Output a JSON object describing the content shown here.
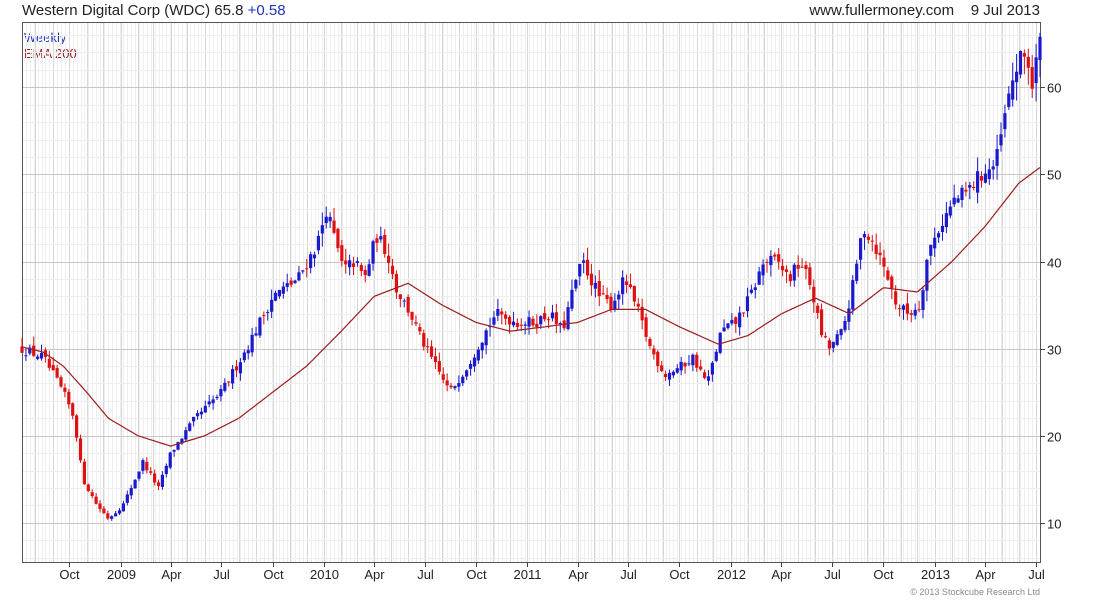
{
  "header": {
    "title": "Western Digital Corp (WDC) 65.8",
    "change": "+0.58",
    "source": "www.fullermoney.com",
    "date": "9 Jul 2013"
  },
  "legend": {
    "weekly": "Weekly",
    "ema": "EMA 200"
  },
  "copyright": "© 2013 Stockcube Research Ltd",
  "colors": {
    "up": "#1a1acc",
    "down": "#dd1111",
    "ema": "#9b1c1c",
    "grid": "#c8c8c8",
    "weekly_text": "#2233bb",
    "ema_text": "#9b1c1c"
  },
  "chart_data": {
    "type": "candlestick",
    "title": "Western Digital Corp (WDC) 65.8 +0.58",
    "interval": "Weekly",
    "y_axis_position": "right",
    "ylim": [
      5.5,
      67.5
    ],
    "yticks": [
      10,
      20,
      30,
      40,
      50,
      60
    ],
    "ytick_labels": [
      "10",
      "20",
      "30",
      "40",
      "50",
      "60"
    ],
    "xlim": [
      "2008-07-08",
      "2013-07-09"
    ],
    "xticks": [
      {
        "date": "2008-10-01",
        "label": "Oct"
      },
      {
        "date": "2009-01-01",
        "label": "2009"
      },
      {
        "date": "2009-04-01",
        "label": "Apr"
      },
      {
        "date": "2009-07-01",
        "label": "Jul"
      },
      {
        "date": "2009-10-01",
        "label": "Oct"
      },
      {
        "date": "2010-01-01",
        "label": "2010"
      },
      {
        "date": "2010-04-01",
        "label": "Apr"
      },
      {
        "date": "2010-07-01",
        "label": "Jul"
      },
      {
        "date": "2010-10-01",
        "label": "Oct"
      },
      {
        "date": "2011-01-01",
        "label": "2011"
      },
      {
        "date": "2011-04-01",
        "label": "Apr"
      },
      {
        "date": "2011-07-01",
        "label": "Jul"
      },
      {
        "date": "2011-10-01",
        "label": "Oct"
      },
      {
        "date": "2012-01-01",
        "label": "2012"
      },
      {
        "date": "2012-04-01",
        "label": "Apr"
      },
      {
        "date": "2012-07-01",
        "label": "Jul"
      },
      {
        "date": "2012-10-01",
        "label": "Oct"
      },
      {
        "date": "2013-01-01",
        "label": "2013"
      },
      {
        "date": "2013-04-01",
        "label": "Apr"
      },
      {
        "date": "2013-07-01",
        "label": "Jul"
      }
    ],
    "price_path": [
      [
        "2008-07-08",
        30
      ],
      [
        "2008-08-15",
        29
      ],
      [
        "2008-09-20",
        25
      ],
      [
        "2008-10-10",
        22
      ],
      [
        "2008-10-25",
        15
      ],
      [
        "2008-11-20",
        12
      ],
      [
        "2008-12-10",
        10.5
      ],
      [
        "2009-01-05",
        12
      ],
      [
        "2009-02-10",
        17
      ],
      [
        "2009-03-10",
        14
      ],
      [
        "2009-04-01",
        18
      ],
      [
        "2009-05-15",
        22
      ],
      [
        "2009-07-01",
        25
      ],
      [
        "2009-08-15",
        30
      ],
      [
        "2009-10-01",
        36
      ],
      [
        "2009-11-15",
        38
      ],
      [
        "2009-12-20",
        42
      ],
      [
        "2010-01-05",
        46
      ],
      [
        "2010-02-05",
        39
      ],
      [
        "2010-02-25",
        40
      ],
      [
        "2010-03-15",
        38
      ],
      [
        "2010-04-05",
        43
      ],
      [
        "2010-04-25",
        41
      ],
      [
        "2010-05-10",
        37
      ],
      [
        "2010-06-05",
        34
      ],
      [
        "2010-06-25",
        31
      ],
      [
        "2010-07-20",
        28
      ],
      [
        "2010-08-15",
        25
      ],
      [
        "2010-09-15",
        28
      ],
      [
        "2010-10-10",
        31
      ],
      [
        "2010-11-05",
        34
      ],
      [
        "2010-12-15",
        33
      ],
      [
        "2011-01-15",
        33
      ],
      [
        "2011-02-10",
        34
      ],
      [
        "2011-03-05",
        32
      ],
      [
        "2011-03-25",
        37
      ],
      [
        "2011-04-10",
        40
      ],
      [
        "2011-05-10",
        36
      ],
      [
        "2011-06-01",
        35
      ],
      [
        "2011-06-25",
        38
      ],
      [
        "2011-07-20",
        34
      ],
      [
        "2011-08-10",
        30
      ],
      [
        "2011-09-05",
        27
      ],
      [
        "2011-10-05",
        28
      ],
      [
        "2011-10-25",
        29
      ],
      [
        "2011-11-20",
        26
      ],
      [
        "2011-12-15",
        32
      ],
      [
        "2012-01-10",
        33
      ],
      [
        "2012-02-05",
        36
      ],
      [
        "2012-03-01",
        40
      ],
      [
        "2012-03-25",
        40
      ],
      [
        "2012-04-15",
        38
      ],
      [
        "2012-05-05",
        40
      ],
      [
        "2012-05-25",
        37
      ],
      [
        "2012-06-10",
        32
      ],
      [
        "2012-06-25",
        30
      ],
      [
        "2012-07-20",
        32
      ],
      [
        "2012-08-10",
        38
      ],
      [
        "2012-08-25",
        44
      ],
      [
        "2012-09-15",
        42
      ],
      [
        "2012-10-10",
        38
      ],
      [
        "2012-10-25",
        35
      ],
      [
        "2012-11-15",
        34
      ],
      [
        "2012-12-05",
        35
      ],
      [
        "2012-12-20",
        41
      ],
      [
        "2013-01-10",
        44
      ],
      [
        "2013-02-05",
        47
      ],
      [
        "2013-03-01",
        48
      ],
      [
        "2013-03-25",
        50
      ],
      [
        "2013-04-20",
        51
      ],
      [
        "2013-05-05",
        56
      ],
      [
        "2013-05-25",
        62
      ],
      [
        "2013-06-15",
        64
      ],
      [
        "2013-06-25",
        60
      ],
      [
        "2013-07-09",
        65.8
      ]
    ],
    "ema_200": [
      [
        "2008-07-08",
        30.2
      ],
      [
        "2008-08-15",
        29.6
      ],
      [
        "2008-09-20",
        28
      ],
      [
        "2008-11-01",
        25
      ],
      [
        "2008-12-10",
        22
      ],
      [
        "2009-02-01",
        20
      ],
      [
        "2009-04-01",
        18.8
      ],
      [
        "2009-06-01",
        20
      ],
      [
        "2009-08-01",
        22
      ],
      [
        "2009-10-01",
        25
      ],
      [
        "2009-12-01",
        28
      ],
      [
        "2010-02-01",
        32
      ],
      [
        "2010-04-01",
        36
      ],
      [
        "2010-06-01",
        37.5
      ],
      [
        "2010-08-01",
        35
      ],
      [
        "2010-10-01",
        33
      ],
      [
        "2010-12-01",
        32
      ],
      [
        "2011-02-01",
        32.5
      ],
      [
        "2011-04-01",
        33
      ],
      [
        "2011-06-01",
        34.5
      ],
      [
        "2011-08-01",
        34.5
      ],
      [
        "2011-10-01",
        32.5
      ],
      [
        "2011-12-10",
        30.5
      ],
      [
        "2012-02-01",
        31.5
      ],
      [
        "2012-04-01",
        34
      ],
      [
        "2012-06-01",
        35.8
      ],
      [
        "2012-08-01",
        34
      ],
      [
        "2012-10-01",
        37
      ],
      [
        "2012-12-01",
        36.5
      ],
      [
        "2013-02-01",
        40
      ],
      [
        "2013-04-01",
        44
      ],
      [
        "2013-06-01",
        49
      ],
      [
        "2013-07-09",
        50.8
      ]
    ]
  }
}
